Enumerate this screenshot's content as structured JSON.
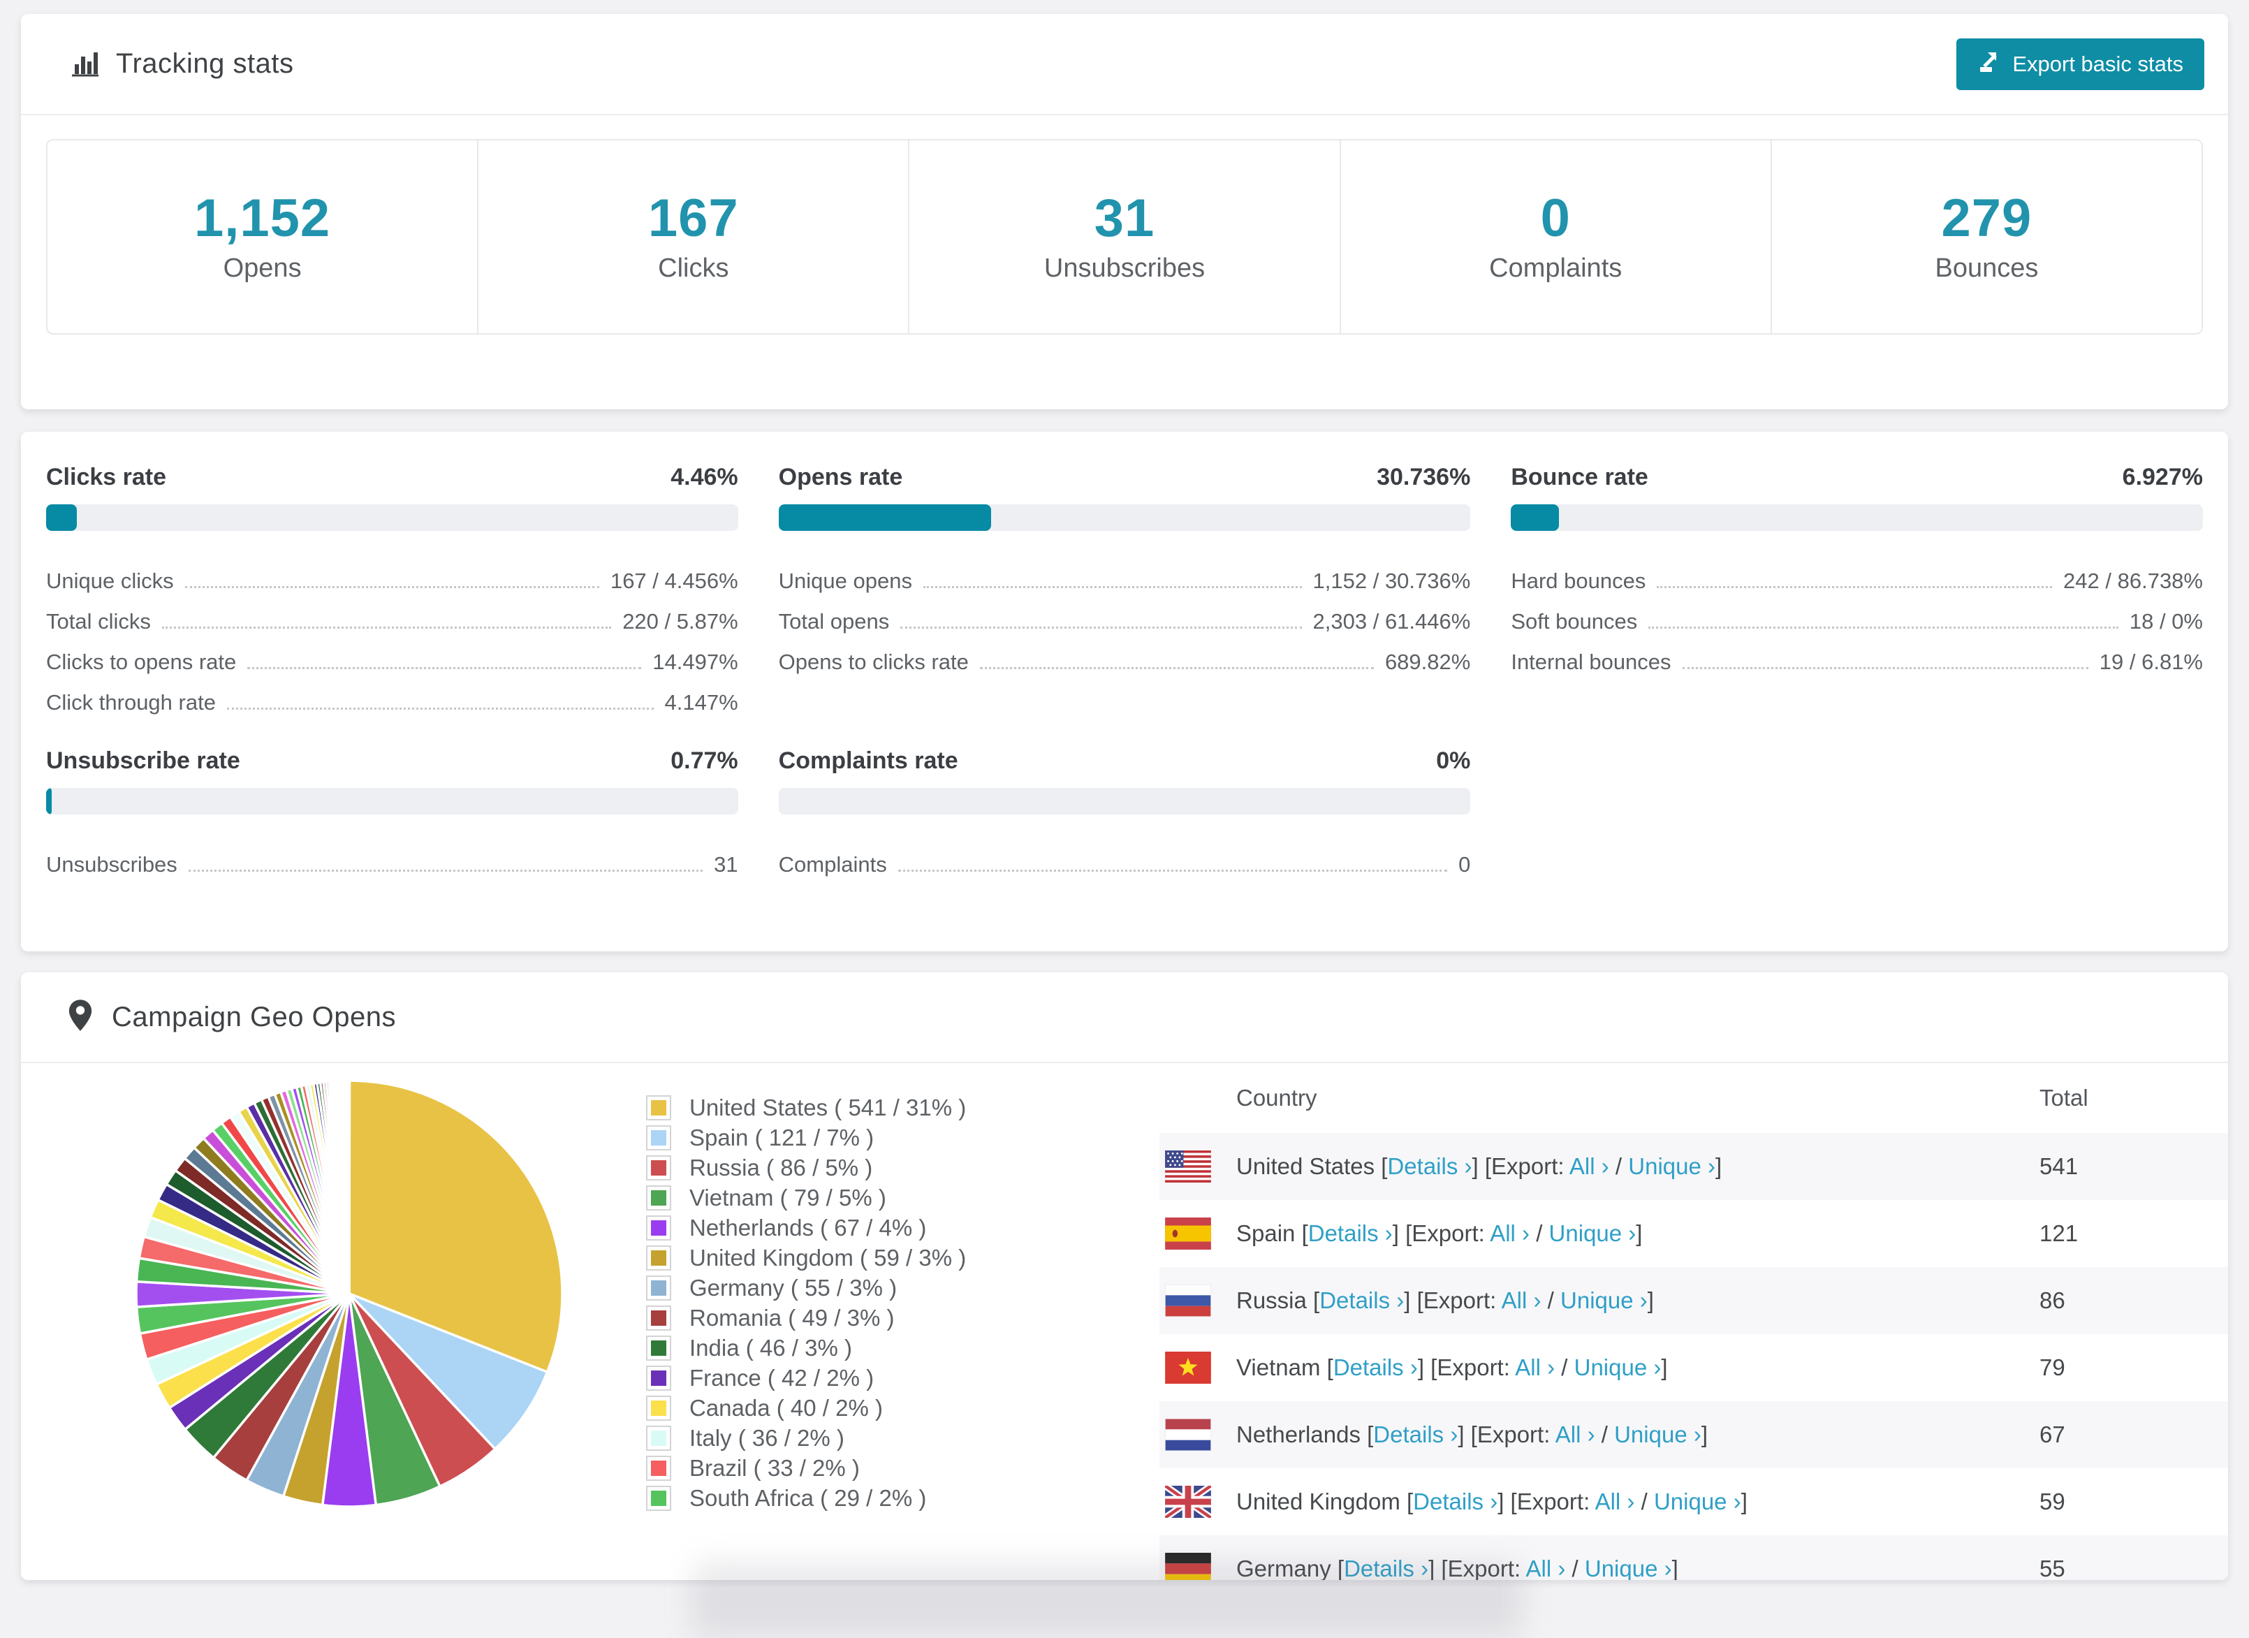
{
  "tracking": {
    "title": "Tracking stats",
    "export_button_label": "Export basic stats",
    "summary": [
      {
        "value": "1,152",
        "label": "Opens"
      },
      {
        "value": "167",
        "label": "Clicks"
      },
      {
        "value": "31",
        "label": "Unsubscribes"
      },
      {
        "value": "0",
        "label": "Complaints"
      },
      {
        "value": "279",
        "label": "Bounces"
      }
    ]
  },
  "rates": {
    "blocks": [
      {
        "title": "Clicks rate",
        "percent_label": "4.46%",
        "percent": 4.46,
        "rows": [
          {
            "label": "Unique clicks",
            "value": "167 / 4.456%"
          },
          {
            "label": "Total clicks",
            "value": "220 / 5.87%"
          },
          {
            "label": "Clicks to opens rate",
            "value": "14.497%"
          },
          {
            "label": "Click through rate",
            "value": "4.147%"
          }
        ]
      },
      {
        "title": "Opens rate",
        "percent_label": "30.736%",
        "percent": 30.736,
        "rows": [
          {
            "label": "Unique opens",
            "value": "1,152 / 30.736%"
          },
          {
            "label": "Total opens",
            "value": "2,303 / 61.446%"
          },
          {
            "label": "Opens to clicks rate",
            "value": "689.82%"
          }
        ]
      },
      {
        "title": "Bounce rate",
        "percent_label": "6.927%",
        "percent": 6.927,
        "rows": [
          {
            "label": "Hard bounces",
            "value": "242 / 86.738%"
          },
          {
            "label": "Soft bounces",
            "value": "18 / 0%"
          },
          {
            "label": "Internal bounces",
            "value": "19 / 6.81%"
          }
        ]
      },
      {
        "title": "Unsubscribe rate",
        "percent_label": "0.77%",
        "percent": 0.77,
        "rows": [
          {
            "label": "Unsubscribes",
            "value": "31"
          }
        ]
      },
      {
        "title": "Complaints rate",
        "percent_label": "0%",
        "percent": 0,
        "rows": [
          {
            "label": "Complaints",
            "value": "0"
          }
        ]
      }
    ]
  },
  "geo": {
    "title": "Campaign Geo Opens",
    "table": {
      "headers": [
        "Country",
        "Total"
      ],
      "labels": {
        "details": "Details ›",
        "export_prefix": "Export:",
        "all": "All ›",
        "unique": "Unique ›"
      },
      "rows": [
        {
          "country": "United States",
          "flag": "us",
          "total": "541"
        },
        {
          "country": "Spain",
          "flag": "es",
          "total": "121"
        },
        {
          "country": "Russia",
          "flag": "ru",
          "total": "86"
        },
        {
          "country": "Vietnam",
          "flag": "vn",
          "total": "79"
        },
        {
          "country": "Netherlands",
          "flag": "nl",
          "total": "67"
        },
        {
          "country": "United Kingdom",
          "flag": "gb",
          "total": "59"
        },
        {
          "country": "Germany",
          "flag": "de",
          "total": "55"
        }
      ]
    }
  },
  "chart_data": {
    "type": "pie",
    "title": "Campaign Geo Opens",
    "categories": [
      "United States",
      "Spain",
      "Russia",
      "Vietnam",
      "Netherlands",
      "United Kingdom",
      "Germany",
      "Romania",
      "India",
      "France",
      "Canada",
      "Italy",
      "Brazil",
      "South Africa"
    ],
    "values": [
      541,
      121,
      86,
      79,
      67,
      59,
      55,
      49,
      46,
      42,
      40,
      36,
      33,
      29
    ],
    "percents": [
      31,
      7,
      5,
      5,
      4,
      3,
      3,
      3,
      3,
      2,
      2,
      2,
      2,
      2
    ],
    "colors": [
      "#e8c245",
      "#abd4f5",
      "#cd4e50",
      "#4ea553",
      "#9a3df0",
      "#c5a22e",
      "#8fb3d2",
      "#a63f3e",
      "#2f7a39",
      "#6a30b8",
      "#fbe04c",
      "#d9fbf6",
      "#f55f5f",
      "#55c45e"
    ],
    "legend_position": "right",
    "legend_format": "{name} ( {value} / {pct}% )",
    "start_angle": "12 o'clock, clockwise",
    "unlabeled_tail": {
      "pct_total": 26,
      "slices": 44,
      "first_pct": 1.9,
      "decay": 0.93,
      "colors": [
        "#a34ff0",
        "#49b653",
        "#f56a6a",
        "#dff8f3",
        "#f4e84b",
        "#352a85",
        "#1d5c2d",
        "#7e2a27",
        "#5d7a94",
        "#8f7b20",
        "#c94fd8",
        "#58d065",
        "#f04848",
        "#eefcfa",
        "#e8d34a",
        "#5a2ea6",
        "#2c6e34",
        "#94312f",
        "#7c93a8",
        "#a8901f",
        "#e06ae0",
        "#8fe08f"
      ]
    }
  },
  "colors": {
    "accent_teal": "#0e8da5",
    "stat_number": "#2193ad",
    "progress_fill": "#078aa4",
    "progress_track": "#edeff2",
    "link": "#2f9fc7",
    "row_shade": "#f7f7f9",
    "page_bg": "#f2f2f4"
  }
}
